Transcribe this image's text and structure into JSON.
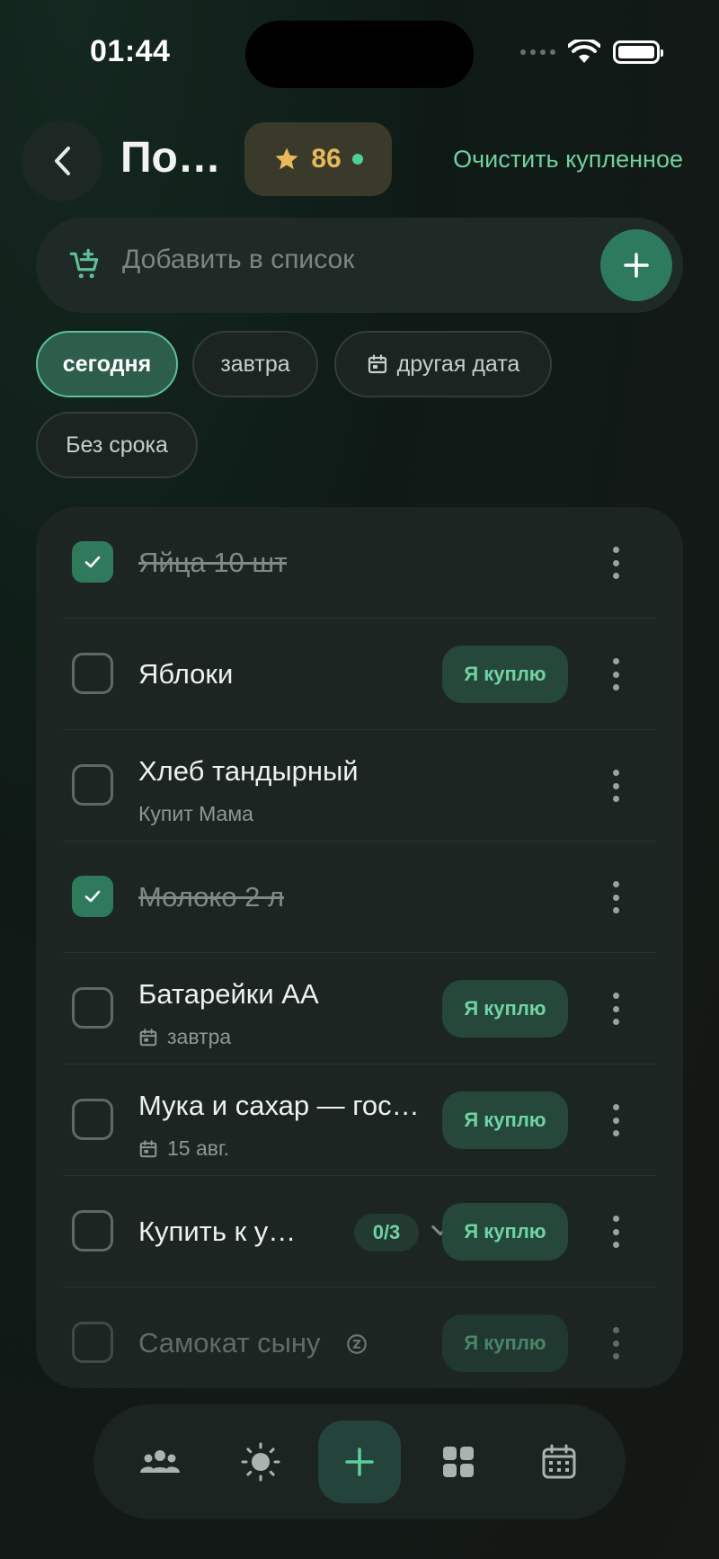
{
  "status": {
    "time": "01:44"
  },
  "header": {
    "title": "По…",
    "score": "86",
    "clear_label": "Очистить купленное"
  },
  "add": {
    "placeholder": "Добавить в список"
  },
  "chips": [
    {
      "label": "сегодня",
      "active": true
    },
    {
      "label": "завтра",
      "active": false
    },
    {
      "label": "другая дата",
      "active": false,
      "icon": "calendar-icon"
    },
    {
      "label": "Без срока",
      "active": false
    }
  ],
  "items": [
    {
      "title": "Яйца 10 шт",
      "done": true
    },
    {
      "title": "Яблоки",
      "done": false,
      "buy_label": "Я куплю"
    },
    {
      "title": "Хлеб тандырный",
      "done": false,
      "sub": "Купит Мама"
    },
    {
      "title": "Молоко 2 л",
      "done": true
    },
    {
      "title": "Батарейки АА",
      "done": false,
      "sub": "завтра",
      "buy_label": "Я куплю"
    },
    {
      "title": "Мука и сахар — гос…",
      "done": false,
      "sub": "15 авг.",
      "buy_label": "Я куплю"
    },
    {
      "title": "Купить к у…",
      "done": false,
      "progress": "0/3",
      "buy_label": "Я куплю"
    },
    {
      "title": "Самокат сыну",
      "done": false,
      "buy_label": "Я куплю",
      "snoozed": true
    }
  ],
  "tabbar": [
    "people-icon",
    "sun-icon",
    "plus-icon",
    "grid-icon",
    "calendar-icon"
  ],
  "colors": {
    "accent": "#6fd3a4",
    "score": "#e8b85a",
    "check": "#2f7a5d"
  }
}
